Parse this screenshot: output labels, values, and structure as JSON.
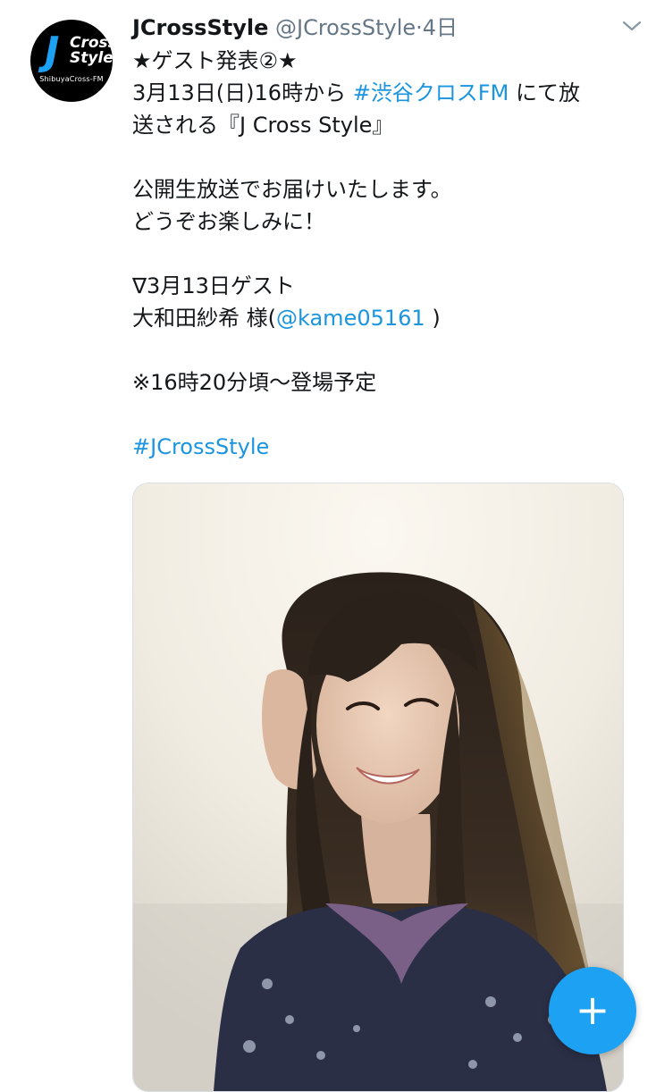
{
  "avatar": {
    "logo_j": "J",
    "logo_cross": "Cross",
    "logo_style": "Style",
    "logo_sub": "ShibuyaCross-FM"
  },
  "header": {
    "display_name": "JCrossStyle",
    "handle": "@JCrossStyle",
    "separator": "·",
    "time": "4日"
  },
  "tweet": {
    "line1": "★ゲスト発表②★",
    "line2_pre": "3月13日(日)16時から ",
    "line2_link": "#渋谷クロスFM",
    "line2_post": " にて放",
    "line3": "送される『J Cross Style』",
    "line4": "公開生放送でお届けいたします。",
    "line5": "どうぞお楽しみに！",
    "line6": "∇3月13日ゲスト",
    "line7_pre": "大和田紗希 様(",
    "line7_link": "@kame05161",
    "line7_post": " )",
    "line8": "※16時20分頃〜登場予定",
    "hashtag": "#JCrossStyle"
  },
  "colors": {
    "link": "#1b95e0",
    "fab": "#1da1f2",
    "secondary_text": "#657786"
  },
  "icons": {
    "more": "chevron-down-icon",
    "compose": "plus-icon"
  },
  "fab": {
    "label": "+"
  }
}
